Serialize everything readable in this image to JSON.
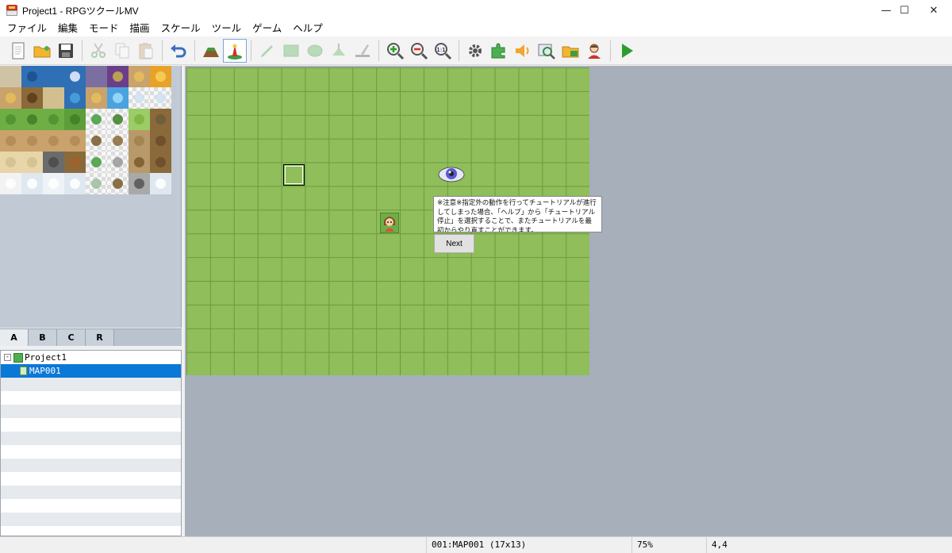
{
  "window": {
    "title": "Project1 - RPGツクールMV",
    "minimize": "—",
    "maximize": "☐",
    "close": "✕"
  },
  "menu": [
    "ファイル",
    "編集",
    "モード",
    "描画",
    "スケール",
    "ツール",
    "ゲーム",
    "ヘルプ"
  ],
  "toolbar": {
    "groups": [
      [
        "new-project-icon",
        "open-project-icon",
        "save-project-icon"
      ],
      [
        "cut-icon",
        "copy-icon",
        "paste-icon"
      ],
      [
        "undo-icon"
      ],
      [
        "map-mode-icon",
        "event-mode-icon"
      ],
      [
        "pencil-icon",
        "rectangle-icon",
        "ellipse-icon",
        "flood-fill-icon",
        "shadow-pen-icon"
      ],
      [
        "zoom-in-icon",
        "zoom-out-icon",
        "actual-size-icon"
      ],
      [
        "database-icon",
        "plugin-manager-icon",
        "sound-test-icon",
        "event-searcher-icon",
        "resource-manager-icon",
        "character-generator-icon"
      ],
      [
        "playtest-icon"
      ]
    ],
    "active": "event-mode-icon",
    "disabled": [
      "cut-icon",
      "copy-icon",
      "paste-icon",
      "pencil-icon",
      "rectangle-icon",
      "ellipse-icon",
      "flood-fill-icon",
      "shadow-pen-icon"
    ]
  },
  "palette_tabs": [
    "A",
    "B",
    "C",
    "R"
  ],
  "palette_active_tab": "A",
  "tree": {
    "project": "Project1",
    "map": "MAP001"
  },
  "map": {
    "tooltip": "※注意※指定外の動作を行ってチュートリアルが進行してしまった場合、「ヘルプ」から「チュートリアル停止」を選択することで、またチュートリアルを最初からやり直すことができます。",
    "next_label": "Next"
  },
  "status": {
    "map_info": "001:MAP001 (17x13)",
    "zoom": "75%",
    "coords": "4,4"
  },
  "colors": {
    "grass": "#8fbe5a",
    "grid": "#6c9a41",
    "selection": "#0a78d7",
    "canvas_bg": "#a7afba"
  }
}
